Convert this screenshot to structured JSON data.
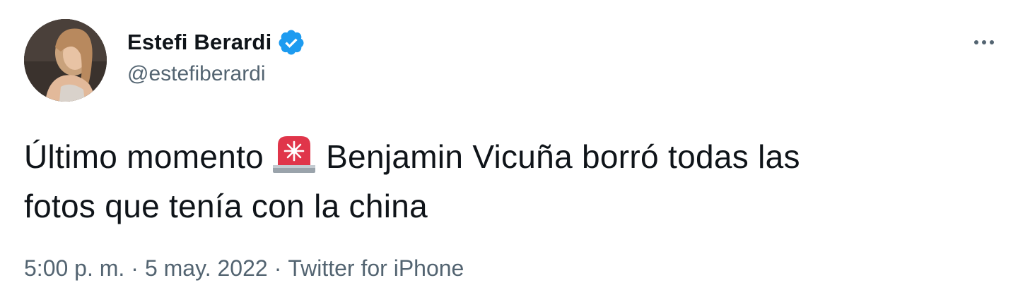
{
  "author": {
    "display_name": "Estefi Berardi",
    "handle": "@estefiberardi",
    "verified": true,
    "avatar_icon": "profile-photo-icon"
  },
  "more_icon": "more-options-icon",
  "tweet": {
    "text_before_emoji": "Último momento",
    "emoji": "rotating-light-emoji",
    "text_after_emoji_line1": "Benjamin Vicuña borró todas las",
    "text_line2": "fotos que tenía con la china"
  },
  "meta": {
    "time": "5:00 p. m.",
    "separator": "·",
    "date": "5 may. 2022",
    "source": "Twitter for iPhone"
  },
  "colors": {
    "text_primary": "#0f1419",
    "text_secondary": "#536471",
    "verified_blue": "#1d9bf0",
    "emoji_red": "#e0354a"
  }
}
